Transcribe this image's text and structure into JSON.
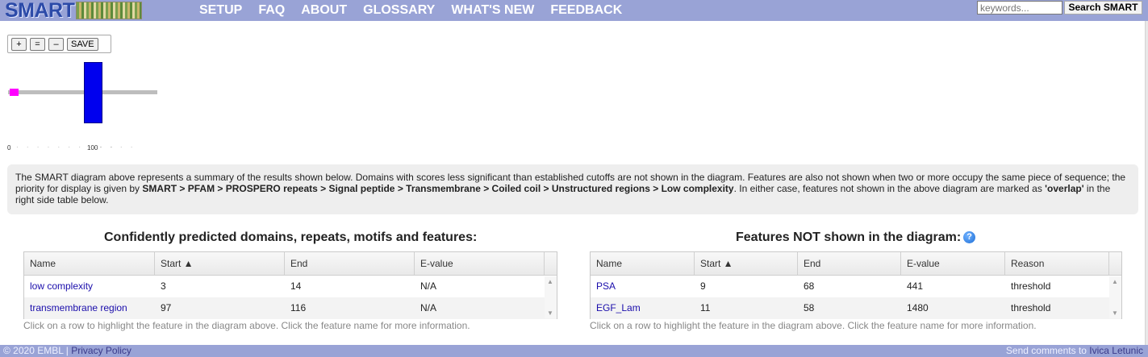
{
  "header": {
    "logo_text": "SMART",
    "nav": [
      "SETUP",
      "FAQ",
      "ABOUT",
      "GLOSSARY",
      "WHAT'S NEW",
      "FEEDBACK"
    ],
    "search_placeholder": "keywords...",
    "search_button": "Search SMART"
  },
  "zoom": {
    "plus": "+",
    "equal": "=",
    "minus": "–",
    "save": "SAVE"
  },
  "diagram": {
    "ticks": [
      "0",
      "100"
    ],
    "colors": {
      "transmembrane": "#0000ee",
      "low_complexity": "#ff00ff",
      "sequence": "#bdbdbd"
    }
  },
  "info": {
    "t1": "The SMART diagram above represents a summary of the results shown below. Domains with scores less significant than established cutoffs are not shown in the diagram. Features are also not shown when two or more occupy the same piece of sequence; the priority for display is given by ",
    "bold1": "SMART > PFAM > PROSPERO repeats > Signal peptide > Transmembrane > Coiled coil > Unstructured regions > Low complexity",
    "t2": ". In either case, features not shown in the above diagram are marked as ",
    "bold2": "'overlap'",
    "t3": " in the right side table below."
  },
  "left_table": {
    "title": "Confidently predicted domains, repeats, motifs and features:",
    "headers": [
      "Name",
      "Start ▲",
      "End",
      "E-value"
    ],
    "rows": [
      {
        "name": "low complexity",
        "start": "3",
        "end": "14",
        "evalue": "N/A"
      },
      {
        "name": "transmembrane region",
        "start": "97",
        "end": "116",
        "evalue": "N/A"
      }
    ],
    "hint": "Click on a row to highlight the feature in the diagram above. Click the feature name for more information."
  },
  "right_table": {
    "title": "Features NOT shown in the diagram:",
    "headers": [
      "Name",
      "Start ▲",
      "End",
      "E-value",
      "Reason"
    ],
    "rows": [
      {
        "name": "PSA",
        "start": "9",
        "end": "68",
        "evalue": "441",
        "reason": "threshold"
      },
      {
        "name": "EGF_Lam",
        "start": "11",
        "end": "58",
        "evalue": "1480",
        "reason": "threshold"
      }
    ],
    "hint": "Click on a row to highlight the feature in the diagram above. Click the feature name for more information."
  },
  "footer": {
    "copyright": "© 2020 EMBL",
    "sep": " | ",
    "privacy": "Privacy Policy",
    "comments": "Send comments to ",
    "author": "Ivica Letunic"
  }
}
